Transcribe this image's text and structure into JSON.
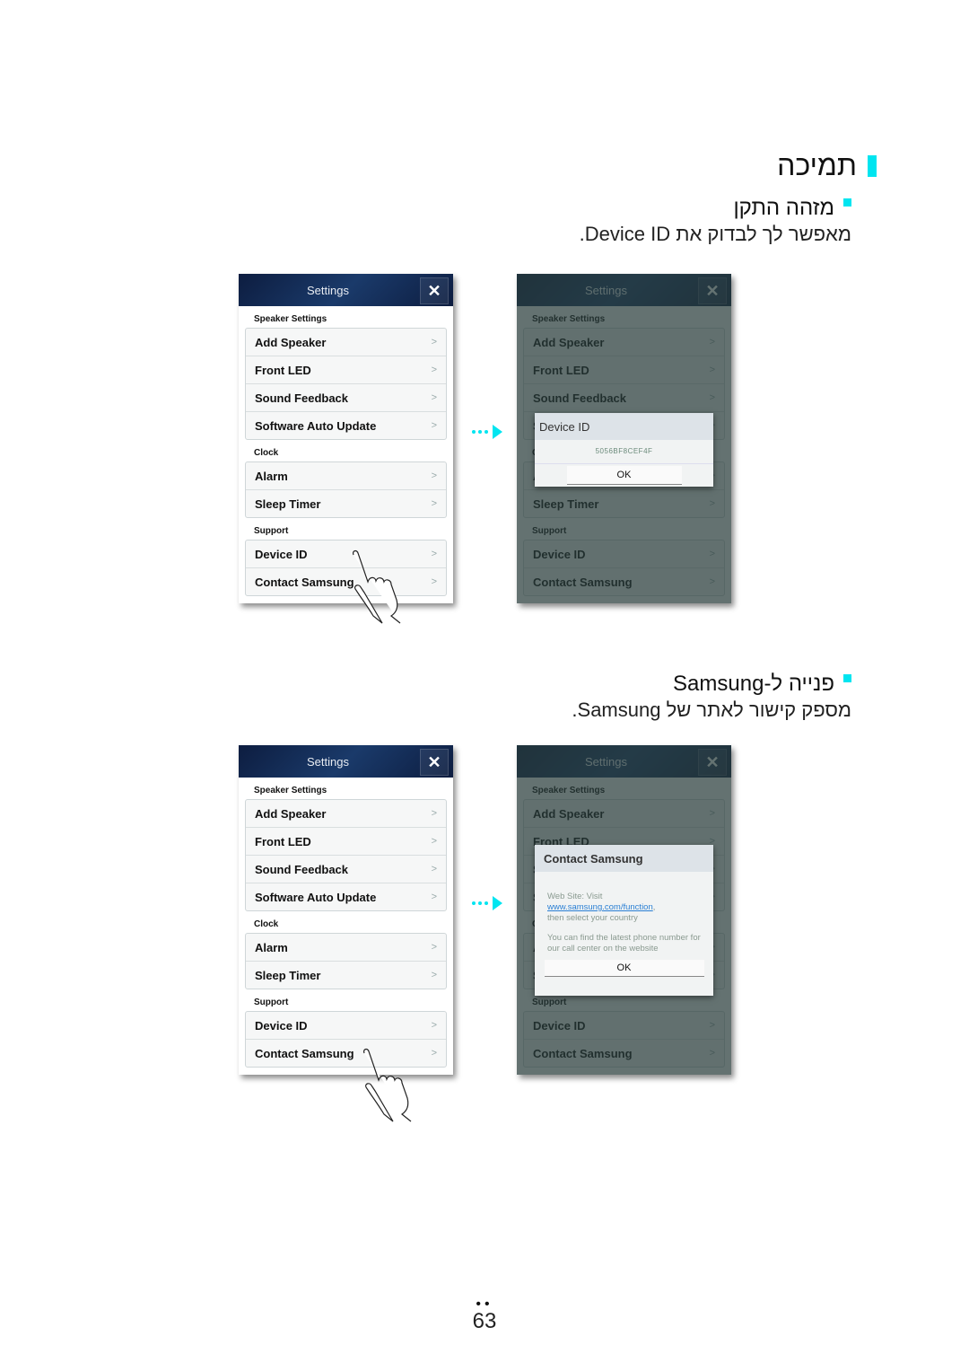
{
  "section": {
    "title": "תמיכה",
    "accent_color": "#00e5f0"
  },
  "device_id_section": {
    "heading": "מזהה התקן",
    "description": "מאפשר לך לבדוק את Device ID."
  },
  "contact_section": {
    "heading": "פנייה ל-Samsung",
    "description": "מספק קישור לאתר של Samsung."
  },
  "settings_panel": {
    "title": "Settings",
    "close_icon": "close-icon",
    "groups": [
      {
        "header": "Speaker Settings",
        "items": [
          "Add Speaker",
          "Front LED",
          "Sound Feedback",
          "Software Auto Update"
        ]
      },
      {
        "header": "Clock",
        "items": [
          "Alarm",
          "Sleep Timer"
        ]
      },
      {
        "header": "Support",
        "items": [
          "Device ID",
          "Contact Samsung"
        ]
      }
    ],
    "chevron": ">"
  },
  "device_id_dialog": {
    "title": "Device ID",
    "value": "5056BF8CEF4F",
    "ok_label": "OK"
  },
  "contact_dialog": {
    "title": "Contact Samsung",
    "line1": "Web Site: Visit",
    "link": "www.samsung.com/function",
    "line1_suffix": ",",
    "line2": "then select your country",
    "line3": "You can find the latest phone number for our call center on the website",
    "ok_label": "OK"
  },
  "page_number": "63",
  "page_dots": "••"
}
